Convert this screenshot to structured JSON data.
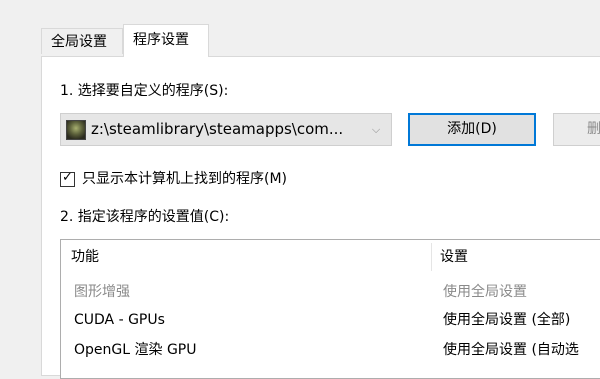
{
  "tabs": [
    {
      "label": "全局设置",
      "active": false
    },
    {
      "label": "程序设置",
      "active": true
    }
  ],
  "step1": {
    "label": "1. 选择要自定义的程序(S):"
  },
  "program_select": {
    "value": "z:\\steamlibrary\\steamapps\\com..."
  },
  "buttons": {
    "add_label": "添加(D)",
    "remove_label": "删"
  },
  "filter_checkbox": {
    "label": "只显示本计算机上找到的程序(M)",
    "checked": true
  },
  "step2": {
    "label": "2. 指定该程序的设置值(C):"
  },
  "settings_table": {
    "headers": {
      "feature": "功能",
      "setting": "设置"
    },
    "rows": [
      {
        "feature": "图形增强",
        "setting": "使用全局设置",
        "disabled": true
      },
      {
        "feature": "CUDA - GPUs",
        "setting": "使用全局设置 (全部)",
        "disabled": false
      },
      {
        "feature": "OpenGL 渲染 GPU",
        "setting": "使用全局设置 (自动选",
        "disabled": false
      }
    ]
  },
  "colors": {
    "focus_accent": "#0078d7",
    "window_bg": "#f0f0f0",
    "disabled_text": "#8a8a8a"
  }
}
